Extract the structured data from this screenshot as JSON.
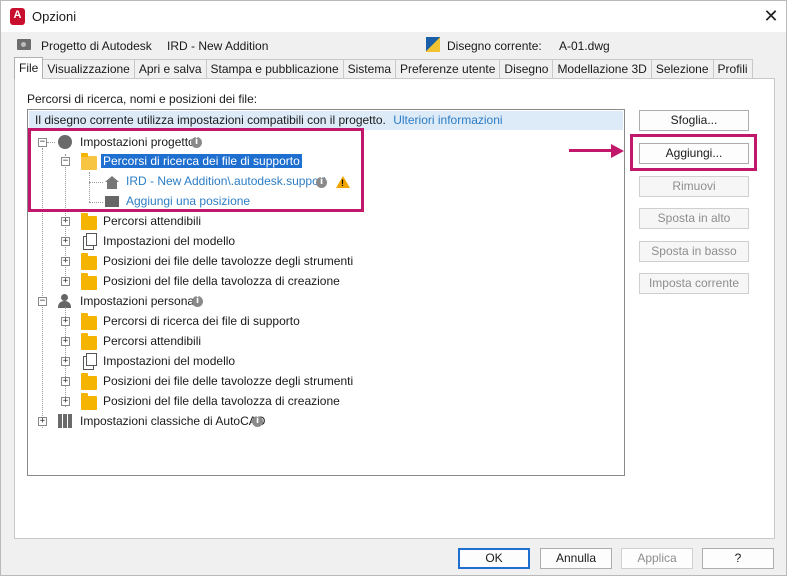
{
  "window": {
    "title": "Opzioni",
    "app_icon": "A",
    "close": "✕"
  },
  "project": {
    "label": "Progetto di Autodesk",
    "name": "IRD - New Addition",
    "drawing_label": "Disegno corrente:",
    "drawing_name": "A-01.dwg"
  },
  "tabs": [
    {
      "label": "File",
      "active": true
    },
    {
      "label": "Visualizzazione"
    },
    {
      "label": "Apri e salva"
    },
    {
      "label": "Stampa e pubblicazione"
    },
    {
      "label": "Sistema"
    },
    {
      "label": "Preferenze utente"
    },
    {
      "label": "Disegno"
    },
    {
      "label": "Modellazione 3D"
    },
    {
      "label": "Selezione"
    },
    {
      "label": "Profili"
    }
  ],
  "panel": {
    "label": "Percorsi di ricerca, nomi e posizioni dei file:",
    "info_text": "Il disegno corrente utilizza impostazioni compatibili con il progetto.",
    "info_link": "Ulteriori informazioni"
  },
  "tree": {
    "project_settings": "Impostazioni progetto",
    "support_paths_selected": "Percorsi di ricerca dei file di supporto",
    "support_path_value": "IRD - New Addition\\.autodesk.support",
    "add_location": "Aggiungi una posizione",
    "project_children": [
      "Percorsi attendibili",
      "Impostazioni del modello",
      "Posizioni dei file delle tavolozze degli strumenti",
      "Posizioni del file della tavolozza di creazione"
    ],
    "personal_settings": "Impostazioni personali",
    "personal_children": [
      "Percorsi di ricerca dei file di supporto",
      "Percorsi attendibili",
      "Impostazioni del modello",
      "Posizioni dei file delle tavolozze degli strumenti",
      "Posizioni del file della tavolozza di creazione"
    ],
    "classic_settings": "Impostazioni classiche di AutoCAD"
  },
  "side_buttons": {
    "browse": "Sfoglia...",
    "add": "Aggiungi...",
    "remove": "Rimuovi",
    "move_up": "Sposta in alto",
    "move_down": "Sposta in basso",
    "set_current": "Imposta corrente"
  },
  "footer": {
    "ok": "OK",
    "cancel": "Annulla",
    "apply": "Applica",
    "help": "?"
  },
  "colors": {
    "highlight": "#c2186b",
    "selection": "#1e6fd0",
    "link": "#2c7dc4",
    "warning": "#f0a400"
  }
}
